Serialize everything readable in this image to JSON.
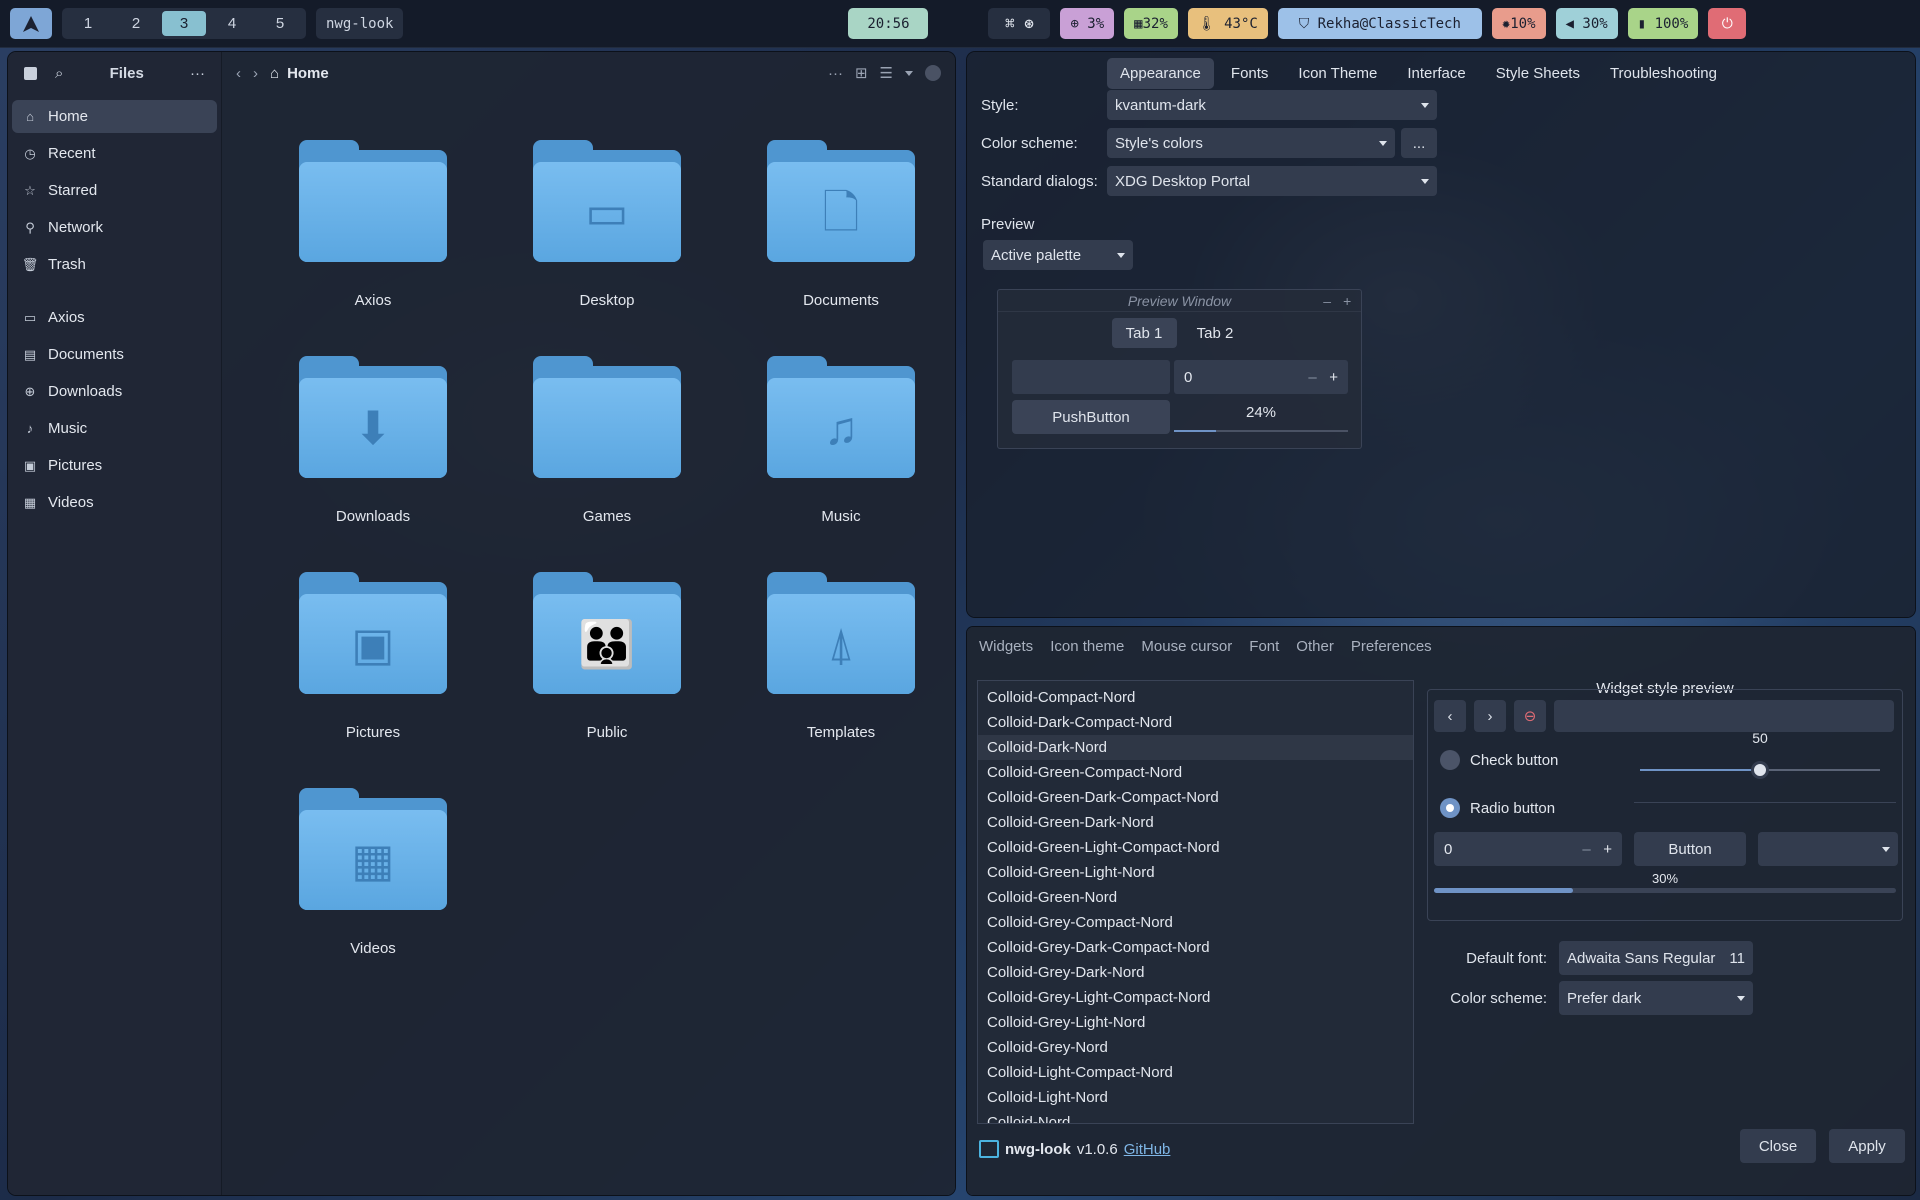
{
  "topbar": {
    "workspaces": [
      "1",
      "2",
      "3",
      "4",
      "5"
    ],
    "active_workspace": "3",
    "window_title": "nwg-look",
    "clock": "20:56",
    "cpu": "3%",
    "memory": "32%",
    "temperature": "43°C",
    "network": "Rekha@ClassicTech",
    "brightness": "10%",
    "volume": "30%",
    "battery": "100%"
  },
  "files": {
    "title": "Files",
    "location": "Home",
    "sidebar": {
      "places": [
        {
          "label": "Home",
          "icon": "home-icon"
        },
        {
          "label": "Recent",
          "icon": "clock-icon"
        },
        {
          "label": "Starred",
          "icon": "star-icon"
        },
        {
          "label": "Network",
          "icon": "network-icon"
        },
        {
          "label": "Trash",
          "icon": "trash-icon"
        }
      ],
      "bookmarks": [
        {
          "label": "Axios",
          "icon": "folder-icon"
        },
        {
          "label": "Documents",
          "icon": "document-icon"
        },
        {
          "label": "Downloads",
          "icon": "download-icon"
        },
        {
          "label": "Music",
          "icon": "music-icon"
        },
        {
          "label": "Pictures",
          "icon": "picture-icon"
        },
        {
          "label": "Videos",
          "icon": "video-icon"
        }
      ]
    },
    "folders": [
      {
        "label": "Axios",
        "glyph": ""
      },
      {
        "label": "Desktop",
        "glyph": "▭"
      },
      {
        "label": "Documents",
        "glyph": "🗋"
      },
      {
        "label": "Downloads",
        "glyph": "⬇"
      },
      {
        "label": "Games",
        "glyph": ""
      },
      {
        "label": "Music",
        "glyph": "♫"
      },
      {
        "label": "Pictures",
        "glyph": "▣"
      },
      {
        "label": "Public",
        "glyph": "👪"
      },
      {
        "label": "Templates",
        "glyph": "⍋"
      },
      {
        "label": "Videos",
        "glyph": "▦"
      }
    ]
  },
  "qt": {
    "tabs": [
      "Appearance",
      "Fonts",
      "Icon Theme",
      "Interface",
      "Style Sheets",
      "Troubleshooting"
    ],
    "active_tab": "Appearance",
    "style_label": "Style:",
    "style_value": "kvantum-dark",
    "color_scheme_label": "Color scheme:",
    "color_scheme_value": "Style's colors",
    "more_button": "...",
    "dialogs_label": "Standard dialogs:",
    "dialogs_value": "XDG Desktop Portal",
    "preview_label": "Preview",
    "palette_value": "Active palette",
    "preview_window": {
      "title": "Preview Window",
      "tab1": "Tab 1",
      "tab2": "Tab 2",
      "spin_value": "0",
      "push_button": "PushButton",
      "progress_text": "24%",
      "progress": 0.24
    }
  },
  "gtk": {
    "tabs": [
      "Widgets",
      "Icon theme",
      "Mouse cursor",
      "Font",
      "Other",
      "Preferences"
    ],
    "themes": [
      "Colloid-Compact-Nord",
      "Colloid-Dark-Compact-Nord",
      "Colloid-Dark-Nord",
      "Colloid-Green-Compact-Nord",
      "Colloid-Green-Dark-Compact-Nord",
      "Colloid-Green-Dark-Nord",
      "Colloid-Green-Light-Compact-Nord",
      "Colloid-Green-Light-Nord",
      "Colloid-Green-Nord",
      "Colloid-Grey-Compact-Nord",
      "Colloid-Grey-Dark-Compact-Nord",
      "Colloid-Grey-Dark-Nord",
      "Colloid-Grey-Light-Compact-Nord",
      "Colloid-Grey-Light-Nord",
      "Colloid-Grey-Nord",
      "Colloid-Light-Compact-Nord",
      "Colloid-Light-Nord",
      "Colloid-Nord"
    ],
    "selected_theme": "Colloid-Dark-Nord",
    "preview": {
      "title": "Widget style preview",
      "slider_value": "50",
      "slider": 0.5,
      "check_label": "Check button",
      "radio_label": "Radio button",
      "spin_value": "0",
      "button_label": "Button",
      "progress_text": "30%",
      "progress": 0.3
    },
    "default_font_label": "Default font:",
    "default_font_value": "Adwaita Sans Regular",
    "default_font_size": "11",
    "color_scheme_label": "Color scheme:",
    "color_scheme_value": "Prefer dark",
    "app_name": "nwg-look",
    "version": "v1.0.6",
    "github": "GitHub",
    "close": "Close",
    "apply": "Apply"
  },
  "colors": {
    "accent": "#88c0d0",
    "folder": "#79bdf0",
    "pill_cpu": "#c9a0d6",
    "pill_mem": "#a9d489",
    "pill_temp": "#e8c07d",
    "pill_net": "#9dc1e8",
    "pill_bright": "#e89c8c",
    "pill_vol": "#9fd0d8",
    "pill_bat": "#a9d489",
    "power": "#e06c75"
  }
}
